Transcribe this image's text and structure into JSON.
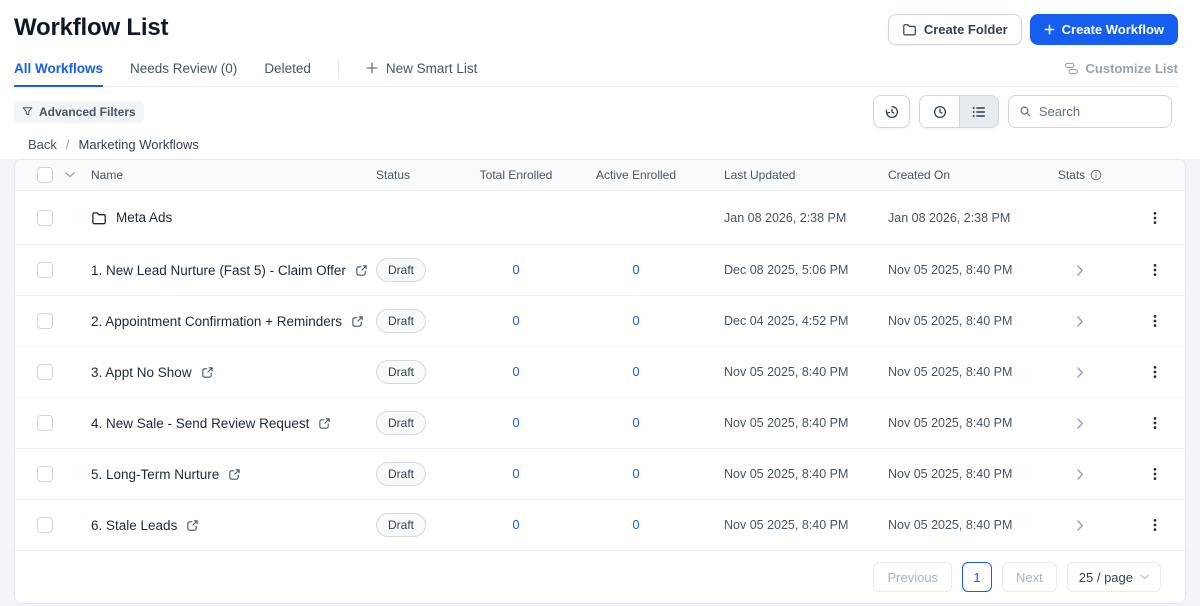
{
  "header": {
    "title": "Workflow List",
    "create_folder_label": "Create Folder",
    "create_workflow_label": "Create Workflow"
  },
  "tabs": {
    "items": [
      {
        "label": "All Workflows",
        "active": true
      },
      {
        "label": "Needs Review (0)",
        "active": false
      },
      {
        "label": "Deleted",
        "active": false
      }
    ],
    "new_smart_list_label": "New Smart List",
    "customize_list_label": "Customize List"
  },
  "filters": {
    "advanced_filters_label": "Advanced Filters",
    "search_placeholder": "Search"
  },
  "breadcrumb": {
    "back": "Back",
    "separator": "/",
    "current": "Marketing Workflows"
  },
  "table": {
    "columns": {
      "name": "Name",
      "status": "Status",
      "total_enrolled": "Total Enrolled",
      "active_enrolled": "Active Enrolled",
      "last_updated": "Last Updated",
      "created_on": "Created On",
      "stats": "Stats"
    },
    "rows": [
      {
        "type": "folder",
        "name": "Meta Ads",
        "status": "",
        "total_enrolled": "",
        "active_enrolled": "",
        "last_updated": "Jan 08 2026, 2:38 PM",
        "created_on": "Jan 08 2026, 2:38 PM"
      },
      {
        "type": "workflow",
        "name": "1. New Lead Nurture (Fast 5) - Claim Offer",
        "status": "Draft",
        "total_enrolled": "0",
        "active_enrolled": "0",
        "last_updated": "Dec 08 2025, 5:06 PM",
        "created_on": "Nov 05 2025, 8:40 PM"
      },
      {
        "type": "workflow",
        "name": "2. Appointment Confirmation + Reminders",
        "status": "Draft",
        "total_enrolled": "0",
        "active_enrolled": "0",
        "last_updated": "Dec 04 2025, 4:52 PM",
        "created_on": "Nov 05 2025, 8:40 PM"
      },
      {
        "type": "workflow",
        "name": "3. Appt No Show",
        "status": "Draft",
        "total_enrolled": "0",
        "active_enrolled": "0",
        "last_updated": "Nov 05 2025, 8:40 PM",
        "created_on": "Nov 05 2025, 8:40 PM"
      },
      {
        "type": "workflow",
        "name": "4. New Sale - Send Review Request",
        "status": "Draft",
        "total_enrolled": "0",
        "active_enrolled": "0",
        "last_updated": "Nov 05 2025, 8:40 PM",
        "created_on": "Nov 05 2025, 8:40 PM"
      },
      {
        "type": "workflow",
        "name": "5. Long-Term Nurture",
        "status": "Draft",
        "total_enrolled": "0",
        "active_enrolled": "0",
        "last_updated": "Nov 05 2025, 8:40 PM",
        "created_on": "Nov 05 2025, 8:40 PM"
      },
      {
        "type": "workflow",
        "name": "6. Stale Leads",
        "status": "Draft",
        "total_enrolled": "0",
        "active_enrolled": "0",
        "last_updated": "Nov 05 2025, 8:40 PM",
        "created_on": "Nov 05 2025, 8:40 PM"
      }
    ]
  },
  "pagination": {
    "previous_label": "Previous",
    "current_page": "1",
    "next_label": "Next",
    "page_size_label": "25 / page"
  },
  "icons": {
    "folder": "folder-icon",
    "plus": "plus-icon",
    "customize": "customize-list-icon",
    "funnel": "funnel-icon",
    "history": "history-icon",
    "clock": "clock-icon",
    "list_view": "list-view-icon",
    "search": "magnifier-icon",
    "info": "info-circle-icon",
    "external_link": "external-link-icon",
    "chevron_right": "chevron-right-icon",
    "chevron_down": "chevron-down-icon",
    "kebab": "kebab-menu-icon"
  },
  "colors": {
    "primary": "#155EEF",
    "link": "#155EEF",
    "badge_border": "#d5d9e0",
    "page_background": "#f2f4f7"
  }
}
